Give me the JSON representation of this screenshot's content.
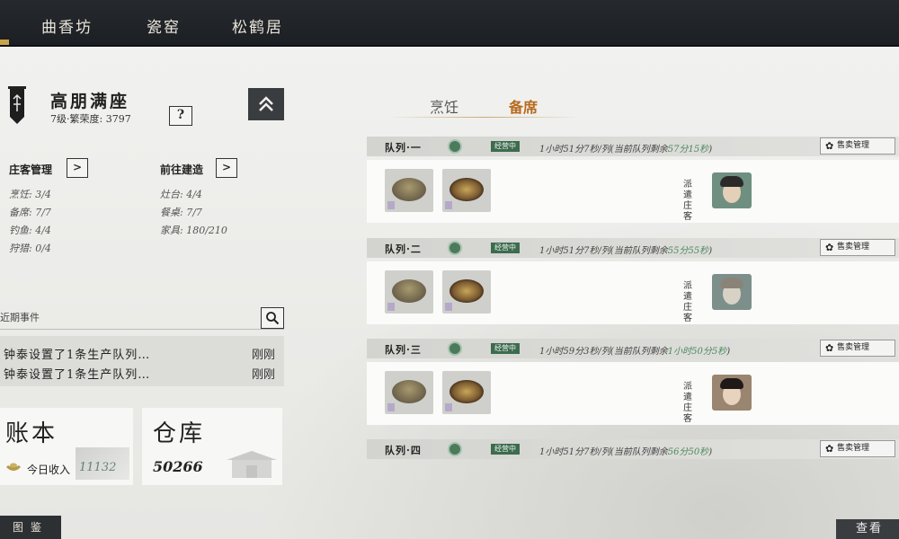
{
  "top_tabs": [
    "曲香坊",
    "瓷窑",
    "松鹤居"
  ],
  "estate": {
    "title": "高朋满座",
    "subtitle": "7级·繁荣度: 3797",
    "help": "?",
    "collapse_icon": "double-chevron-up-icon"
  },
  "manage": {
    "label": "庄客管理",
    "arrow": ">",
    "stats": [
      "烹饪: 3/4",
      "备席: 7/7",
      "钓鱼: 4/4",
      "狩猎: 0/4"
    ]
  },
  "build": {
    "label": "前往建造",
    "arrow": ">",
    "stats": [
      "灶台: 4/4",
      "餐桌: 7/7",
      "家具: 180/210"
    ]
  },
  "events": {
    "label": "近期事件",
    "items": [
      {
        "text": "钟泰设置了1条生产队列…",
        "time": "刚刚"
      },
      {
        "text": "钟泰设置了1条生产队列…",
        "time": "刚刚"
      }
    ]
  },
  "ledger": {
    "title": "账本",
    "income_label": "今日收入",
    "income_value": "11132"
  },
  "warehouse": {
    "title": "仓库",
    "value": "50266"
  },
  "bottom_tag": "图鉴",
  "right_tabs": {
    "cook": "烹饪",
    "prepare": "备席"
  },
  "queues": [
    {
      "name": "队列·一",
      "status": "经营中",
      "timer_a": "1小时51分7秒/列(当前队列剩余",
      "timer_b": "57分15秒",
      "timer_c": ")",
      "sell": "售卖管理",
      "assign": "派遣庄客",
      "has_body": true
    },
    {
      "name": "队列·二",
      "status": "经营中",
      "timer_a": "1小时51分7秒/列(当前队列剩余",
      "timer_b": "55分55秒",
      "timer_c": ")",
      "sell": "售卖管理",
      "assign": "派遣庄客",
      "has_body": true
    },
    {
      "name": "队列·三",
      "status": "经营中",
      "timer_a": "1小时59分3秒/列(当前队列剩余",
      "timer_b": "1小时50分5秒",
      "timer_c": ")",
      "sell": "售卖管理",
      "assign": "派遣庄客",
      "has_body": true
    },
    {
      "name": "队列·四",
      "status": "经营中",
      "timer_a": "1小时51分7秒/列(当前队列剩余",
      "timer_b": "56分50秒",
      "timer_c": ")",
      "sell": "售卖管理",
      "assign": "",
      "has_body": false
    }
  ],
  "view_button": "查看"
}
